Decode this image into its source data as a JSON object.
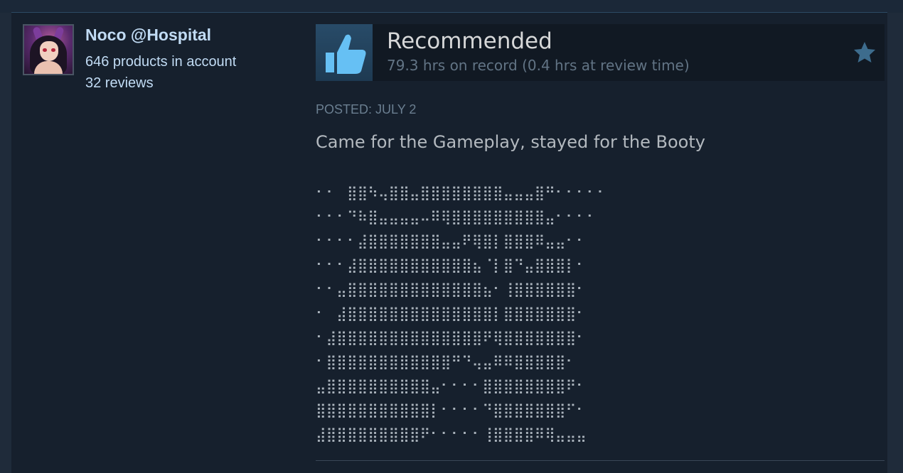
{
  "author": {
    "name": "Noco @Hospital",
    "products": "646 products in account",
    "reviews": "32 reviews"
  },
  "review": {
    "verdict": "Recommended",
    "hours": "79.3 hrs on record (0.4 hrs at review time)",
    "posted": "POSTED: JULY 2",
    "text": "Came for the Gameplay, stayed for the Booty",
    "ascii_art": "⠂⠂⠀⣿⣿⠳⢤⣿⣿⣤⣿⣿⣿⣿⣿⣿⣿⣿⣤⣤⣤⣿⠛⠂⠂⠂⠂⠂\n⠂⠂⠂⠙⠷⣿⣤⣤⣤⣤⠤⠿⢿⣿⣿⣿⣿⣿⣿⣿⣿⣿⣤⠂⠂⠂⠂\n⠂⠂⠂⠂⣼⣿⣿⣿⣿⣿⣿⣿⣤⣤⠟⢿⣿⡇⣿⣿⣿⠿⣤⣤⠂⠂\n⠂⠂⠂⣼⣿⣿⣿⣿⣿⣿⣿⣿⣿⣿⣿⣦⠈⡇⣿⠙⣤⣿⣿⣿⡇⠂\n⠂⠂⣤⣿⣿⣿⣿⣿⣿⣿⣿⣿⣿⣿⣿⣿⣦⠂⢸⣿⣿⣿⣿⣿⣿⠂\n⠂⠀⣼⣿⣿⣿⣿⣿⣿⣿⣿⣿⣿⣿⣿⣿⣿⡇⣿⣿⣿⣿⣿⣿⣿⠂\n⠂⣼⣿⣿⣿⣿⣿⣿⣿⣿⣿⣿⣿⣿⣿⣿⠟⢿⣿⣿⣿⣿⣿⣿⣿⠂\n⠂⣿⣿⣿⣿⣿⣿⣿⣿⣿⣿⣿⣿⠛⠙⢤⣤⠿⠿⣿⣿⣿⣿⣿⠂\n⣤⣿⣿⣿⣿⣿⣿⣿⣿⣿⣿⣤⠂⠂⠂⠂⣿⣿⣿⣿⣿⣿⣿⣿⠟⠂\n⣿⣿⣿⣿⣿⣿⣿⣿⣿⣿⣿⡇⠂⠂⠂⠂⠙⣿⣿⣿⣿⣿⣿⣿⠋⠂\n⣼⣿⣿⣿⣿⣿⣿⣿⣿⣿⠟⠂⠂⠂⠂⠂⢸⣿⣿⣿⣿⠿⢿⣤⣤⣤"
  },
  "icons": {
    "thumb": "thumbs-up-icon",
    "star": "star-icon"
  },
  "colors": {
    "background": "#1f2b3a",
    "card": "#16202d",
    "name": "#c1dbf4",
    "thumb": "#66c0f4"
  }
}
